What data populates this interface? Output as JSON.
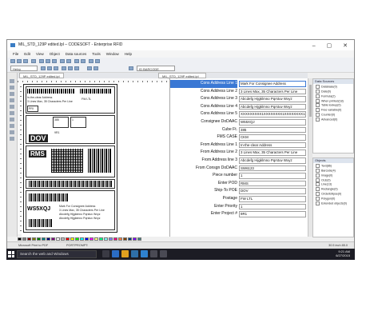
{
  "window": {
    "title": "MIL_STD_129P edited.lpl – CODESOFT - Enterprise RFID",
    "controls": "–  ▢  ✕"
  },
  "menu": [
    "File",
    "Edit",
    "View",
    "Object",
    "Data sources",
    "Tools",
    "Window",
    "Help"
  ],
  "toolbar": {
    "zoom_value": "Helvy",
    "object_combo": "ID BARCODE"
  },
  "document_tab": "MIL_STD_129P edited.lpl",
  "label_preview": {
    "pri_code": "PRI",
    "id_text": "WS5XQJ",
    "dov_text": "DOV",
    "rms_text": "RMS"
  },
  "properties": [
    {
      "label": "Cons Address Line 1",
      "value": "Mark For Consignee Address",
      "selected": true
    },
    {
      "label": "Cons Address Line 2",
      "value": "3 Lines Max, 35 Characters Per Line",
      "selected": false
    },
    {
      "label": "Cons Address Line 3",
      "value": "Abcdefg Hijgklmno Pqrstuv Wxyz",
      "selected": false
    },
    {
      "label": "Cons Address Line 4",
      "value": "Abcdefg Hijgklmno Pqrstuv Wxyz",
      "selected": false
    },
    {
      "label": "Cons Address Line 5",
      "value": "XXXXXXXXX1XXXXXXXX1XXXXXXXX1XXX",
      "selected": false
    },
    {
      "label": "Consignee DoDAAC",
      "value": "W55XQJ",
      "selected": false
    },
    {
      "label": "Cube Ft.",
      "value": "385",
      "selected": false
    },
    {
      "label": "FMS CASE",
      "value": "CKM",
      "selected": false
    },
    {
      "label": "From Address Line 1",
      "value": "In-the-clear Address",
      "selected": false
    },
    {
      "label": "From Address Line 2",
      "value": "3 Lines Max, 35 Characters Per Line",
      "selected": false
    },
    {
      "label": "From Address line 3",
      "value": "Abcdefg Hijgklmno Pqrstuv Wxyz",
      "selected": false
    },
    {
      "label": "From Consgn DoDAAC",
      "value": "SW6123",
      "selected": false
    },
    {
      "label": "Piece number",
      "value": "1",
      "selected": false
    },
    {
      "label": "Enter POD",
      "value": "RMS",
      "selected": false
    },
    {
      "label": "Ship-To POE",
      "value": "DOV",
      "selected": false
    },
    {
      "label": "Postage",
      "value": "FW LTL",
      "selected": false
    },
    {
      "label": "Enter Priority",
      "value": "1",
      "selected": false
    },
    {
      "label": "Enter Project #",
      "value": "9R1",
      "selected": false
    }
  ],
  "data_sources_panel": {
    "title": "Data Sources",
    "items": [
      "Database(0)",
      "Date(0)",
      "Formula(2)",
      "When printed(18)",
      "Table lookup(0)",
      "Free variable(0)",
      "Counter(0)",
      "Advanced(0)"
    ]
  },
  "objects_panel": {
    "title": "Objects",
    "items": [
      "Text(86)",
      "Barcode(4)",
      "Image(0)",
      "OLE(0)",
      "Line(13)",
      "Rectangle(0)",
      "Circle/Ellipse(0)",
      "Polygon(0)",
      "Extended objects(0)"
    ]
  },
  "status": {
    "left": "Microsoft Print to PDF",
    "middle": "PORTPROMPT:",
    "right": "30.5 inch 85.0"
  },
  "taskbar": {
    "search_placeholder": "Search the web and Windows",
    "time": "9:21 AM",
    "date": "6/27/2015"
  },
  "colors": {
    "selection": "#3a78d4",
    "taskbar": "#1c1c24"
  },
  "icons": [
    "app-icon",
    "windows-start-icon",
    "folder-icon",
    "edge-icon",
    "store-icon",
    "mail-icon"
  ]
}
